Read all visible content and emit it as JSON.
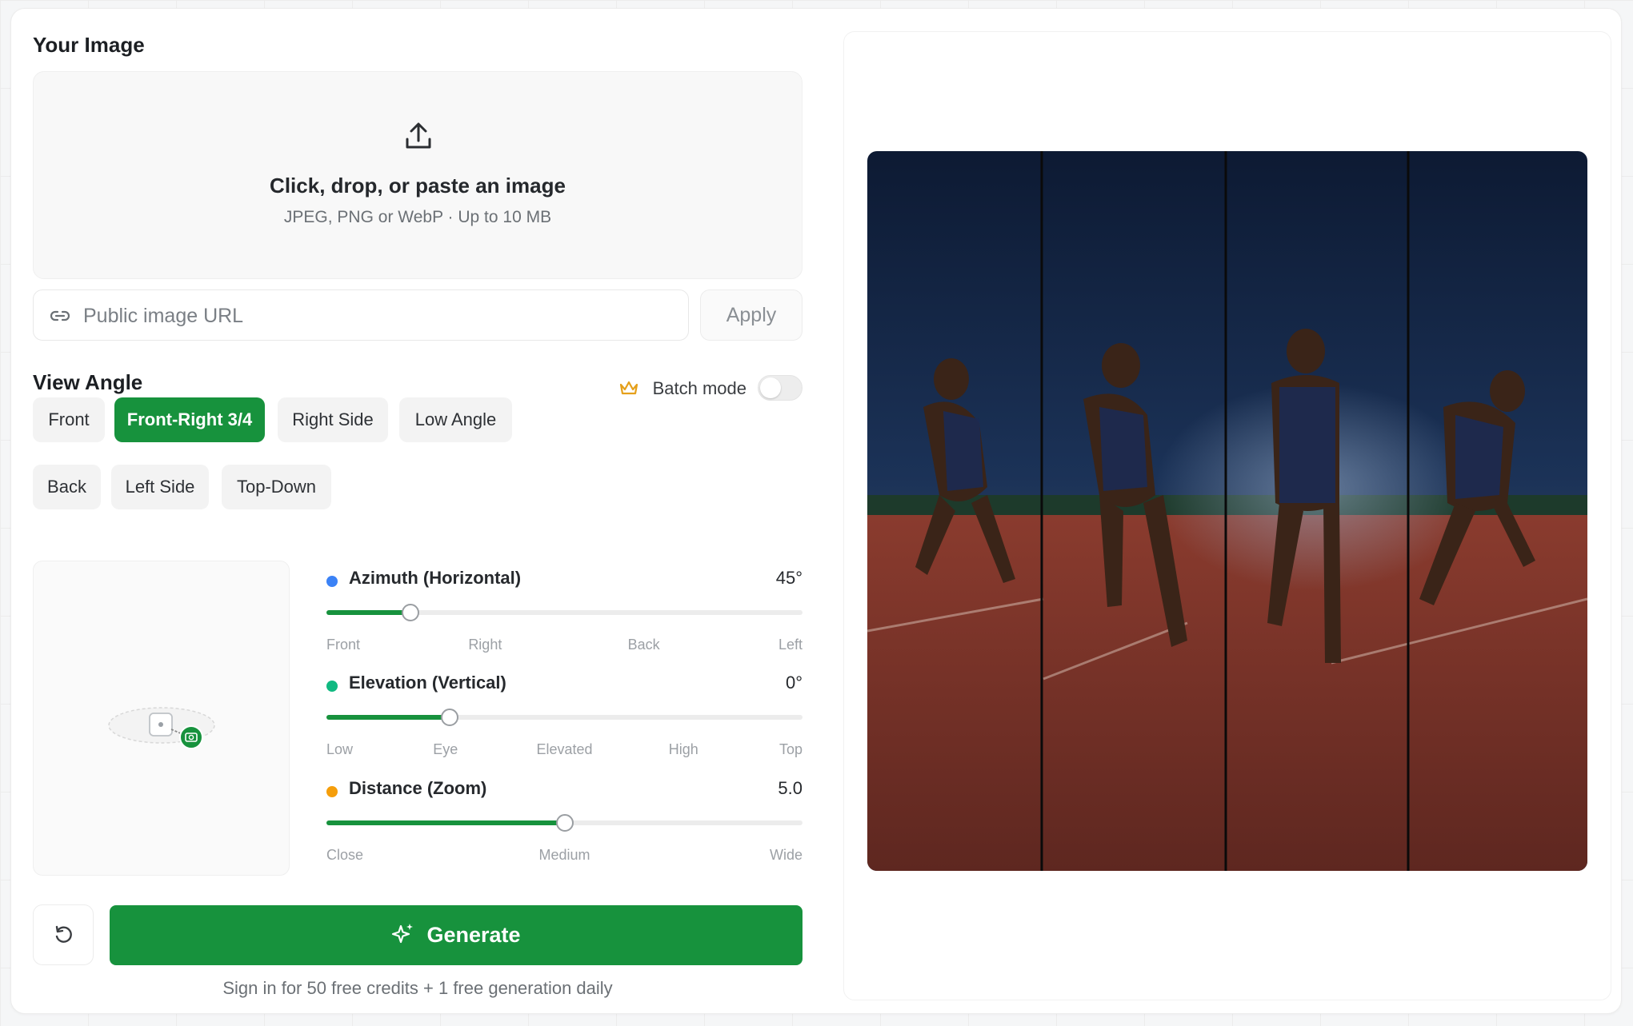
{
  "upload": {
    "section_title": "Your Image",
    "drop_title": "Click, drop, or paste an image",
    "drop_hint": "JPEG, PNG or WebP · Up to 10 MB",
    "url_placeholder": "Public image URL",
    "apply_label": "Apply"
  },
  "view_angle": {
    "section_title": "View Angle",
    "batch_label": "Batch mode",
    "batch_enabled": false,
    "presets_row1": [
      "Front",
      "Front-Right 3/4",
      "Right Side",
      "Low Angle"
    ],
    "presets_row2": [
      "Back",
      "Left Side",
      "Top-Down"
    ],
    "active_preset": "Front-Right 3/4"
  },
  "sliders": {
    "azimuth": {
      "label": "Azimuth (Horizontal)",
      "value_text": "45°",
      "fraction": 0.177,
      "dot_color": "#3b82f6",
      "ticks": [
        "Front",
        "Right",
        "Back",
        "Left"
      ]
    },
    "elevation": {
      "label": "Elevation (Vertical)",
      "value_text": "0°",
      "fraction": 0.258,
      "dot_color": "#10b981",
      "ticks": [
        "Low",
        "Eye",
        "Elevated",
        "High",
        "Top"
      ]
    },
    "distance": {
      "label": "Distance (Zoom)",
      "value_text": "5.0",
      "fraction": 0.5,
      "dot_color": "#f59e0b",
      "ticks": [
        "Close",
        "Medium",
        "Wide"
      ]
    }
  },
  "actions": {
    "generate_label": "Generate",
    "signin_note": "Sign in for 50 free credits + 1 free generation daily"
  },
  "colors": {
    "accent": "#17923d"
  },
  "icons": [
    "upload-icon",
    "link-icon",
    "crown-icon",
    "camera-icon",
    "reset-icon",
    "sparkles-icon"
  ]
}
